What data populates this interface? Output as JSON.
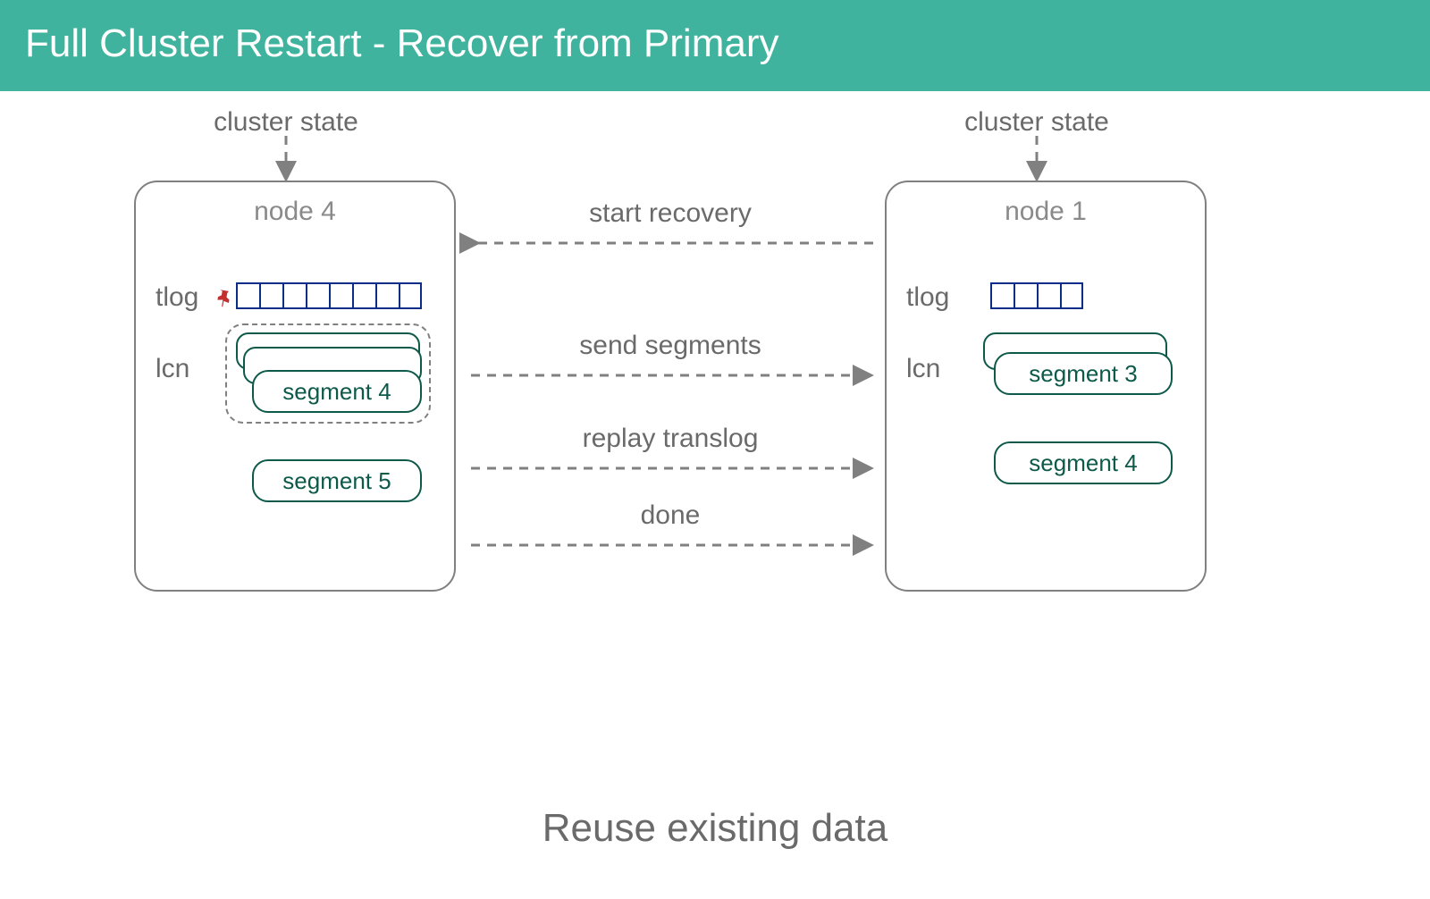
{
  "title": "Full Cluster Restart - Recover from Primary",
  "cluster_state_label": "cluster state",
  "node_left": {
    "title": "node 4",
    "tlog_label": "tlog",
    "lcn_label": "lcn",
    "tlog_count": 8,
    "segments": {
      "grouped_front": "segment 4",
      "extra": "segment 5"
    }
  },
  "node_right": {
    "title": "node 1",
    "tlog_label": "tlog",
    "lcn_label": "lcn",
    "tlog_count": 4,
    "segments": {
      "top": "segment 3",
      "bottom": "segment 4"
    }
  },
  "messages": {
    "start": "start recovery",
    "send": "send segments",
    "replay": "replay translog",
    "done": "done"
  },
  "footer": "Reuse existing data"
}
